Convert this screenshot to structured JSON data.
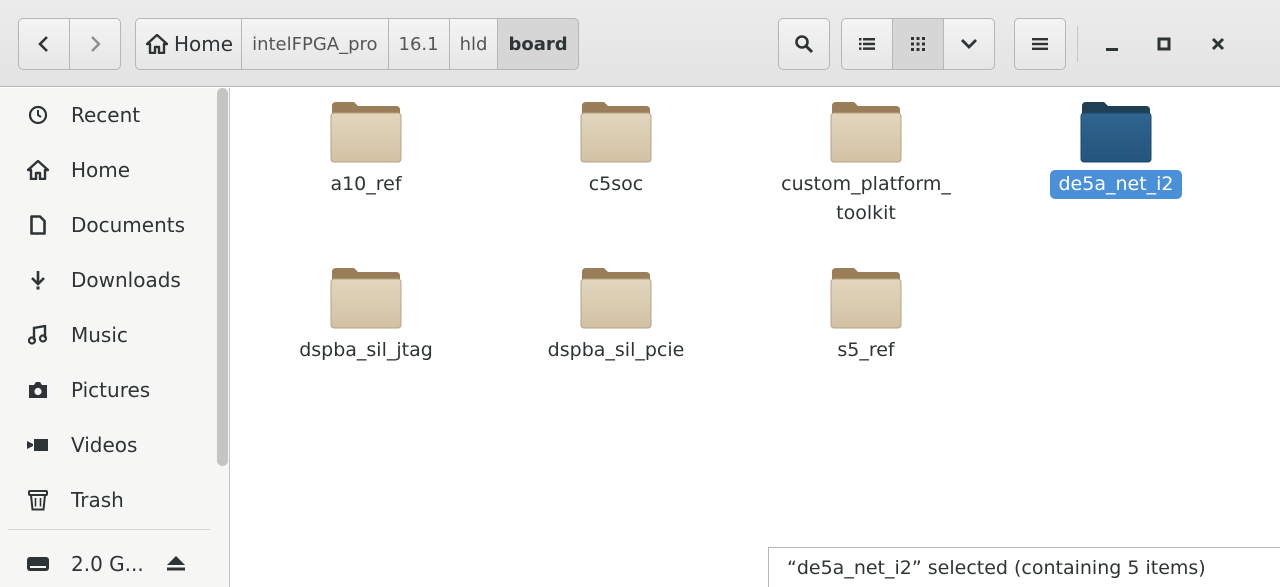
{
  "header": {
    "back_icon": "chevron-left-icon",
    "forward_icon": "chevron-right-icon",
    "breadcrumbs": [
      {
        "label": "Home",
        "icon": "home-icon"
      },
      {
        "label": "intelFPGA_pro"
      },
      {
        "label": "16.1"
      },
      {
        "label": "hld"
      },
      {
        "label": "board"
      }
    ],
    "active_crumb": "board",
    "search_icon": "search-icon",
    "view_list_icon": "list-view-icon",
    "view_grid_icon": "grid-view-icon",
    "view_options_icon": "chevron-down-icon",
    "menu_icon": "hamburger-menu-icon",
    "minimize_icon": "minimize-icon",
    "maximize_icon": "maximize-icon",
    "close_icon": "close-icon"
  },
  "sidebar": {
    "items": [
      {
        "label": "Recent",
        "icon": "clock-icon"
      },
      {
        "label": "Home",
        "icon": "home-icon"
      },
      {
        "label": "Documents",
        "icon": "document-icon"
      },
      {
        "label": "Downloads",
        "icon": "download-icon"
      },
      {
        "label": "Music",
        "icon": "music-icon"
      },
      {
        "label": "Pictures",
        "icon": "camera-icon"
      },
      {
        "label": "Videos",
        "icon": "video-icon"
      },
      {
        "label": "Trash",
        "icon": "trash-icon"
      }
    ],
    "devices": [
      {
        "label": "2.0 G...",
        "icon": "drive-icon",
        "action_icon": "eject-icon"
      }
    ]
  },
  "main": {
    "folders": [
      {
        "name": "a10_ref",
        "selected": false
      },
      {
        "name": "c5soc",
        "selected": false
      },
      {
        "name": "custom_platform_ toolkit",
        "selected": false
      },
      {
        "name": "de5a_net_i2",
        "selected": true
      },
      {
        "name": "dspba_sil_jtag",
        "selected": false
      },
      {
        "name": "dspba_sil_pcie",
        "selected": false
      },
      {
        "name": "s5_ref",
        "selected": false
      }
    ]
  },
  "status": {
    "text": "“de5a_net_i2” selected  (containing 5 items)"
  },
  "colors": {
    "selection": "#4a90d9",
    "folder_tan": "#d8c9ad",
    "folder_selected": "#2a5a82"
  }
}
